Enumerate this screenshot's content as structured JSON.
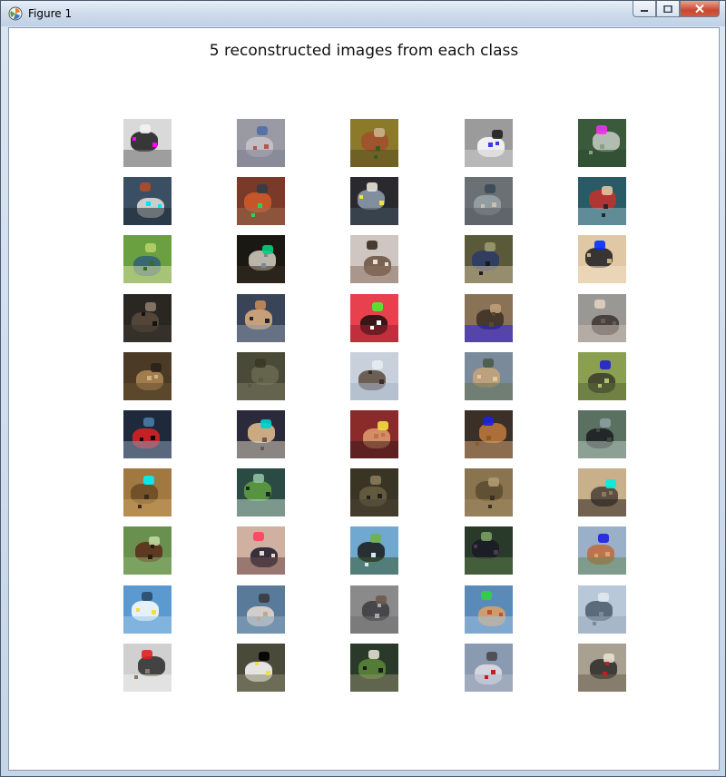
{
  "window": {
    "title": "Figure 1",
    "app_icon": "matplotlib-icon",
    "controls": [
      "minimize-icon",
      "maximize-icon",
      "close-icon"
    ]
  },
  "figure": {
    "title": "5 reconstructed images from each class",
    "rows": 10,
    "cols": 5
  },
  "images": [
    [
      {
        "bg": "#d9d9d9",
        "c1": "#1a1a1a",
        "c2": "#f2f2f2",
        "c3": "#ff00ff",
        "c4": "#6d6d6d"
      },
      {
        "bg": "#9a9aa4",
        "c1": "#c9c4cc",
        "c2": "#4f6fa8",
        "c3": "#b0574e",
        "c4": "#7b7f8f"
      },
      {
        "bg": "#8a7a2a",
        "c1": "#a14f2c",
        "c2": "#c9b08a",
        "c3": "#3a5a24",
        "c4": "#5a4a20"
      },
      {
        "bg": "#9b9b9b",
        "c1": "#ffffff",
        "c2": "#202020",
        "c3": "#3a3af0",
        "c4": "#d0d0d0"
      },
      {
        "bg": "#3b5a3c",
        "c1": "#c8cfc6",
        "c2": "#ee33ee",
        "c3": "#8aa37e",
        "c4": "#2d4a30"
      }
    ],
    [
      {
        "bg": "#3a4f63",
        "c1": "#e8e2dc",
        "c2": "#b04a2a",
        "c3": "#00e5ff",
        "c4": "#1d2a35"
      },
      {
        "bg": "#7a3a2a",
        "c1": "#d45a2a",
        "c2": "#333c46",
        "c3": "#2ed05c",
        "c4": "#9c6a4a"
      },
      {
        "bg": "#2a2a2e",
        "c1": "#8fa0b0",
        "c2": "#e7e2d8",
        "c3": "#f5e04a",
        "c4": "#445566"
      },
      {
        "bg": "#6a7074",
        "c1": "#9aa3a8",
        "c2": "#3a4a56",
        "c3": "#c8c0b0",
        "c4": "#555d62"
      },
      {
        "bg": "#2a5a66",
        "c1": "#c8302a",
        "c2": "#e2c4a0",
        "c3": "#1f2a30",
        "c4": "#8ab6c0"
      }
    ],
    [
      {
        "bg": "#6aa040",
        "c1": "#2f5f7a",
        "c2": "#b6d06a",
        "c3": "#3c6a28",
        "c4": "#d9e0a0"
      },
      {
        "bg": "#1a1812",
        "c1": "#d8d0c4",
        "c2": "#00d080",
        "c3": "#7a8898",
        "c4": "#3a3024"
      },
      {
        "bg": "#cfc6c2",
        "c1": "#6a5040",
        "c2": "#3a2c22",
        "c3": "#e6e0dc",
        "c4": "#8a7060"
      },
      {
        "bg": "#5a5a3a",
        "c1": "#2a3a6a",
        "c2": "#9a9a70",
        "c3": "#1a1a16",
        "c4": "#c8b898"
      },
      {
        "bg": "#e0c8a4",
        "c1": "#1a1a20",
        "c2": "#0030ff",
        "c3": "#c8ac84",
        "c4": "#f2e0c4"
      }
    ],
    [
      {
        "bg": "#2a2622",
        "c1": "#5a4c3c",
        "c2": "#8a7a6a",
        "c3": "#141210",
        "c4": "#3e3830"
      },
      {
        "bg": "#3a4458",
        "c1": "#e0b080",
        "c2": "#c48a5a",
        "c3": "#1e2430",
        "c4": "#8a98a8"
      },
      {
        "bg": "#e8404c",
        "c1": "#1a1010",
        "c2": "#50f030",
        "c3": "#ffffff",
        "c4": "#a02030"
      },
      {
        "bg": "#8a7256",
        "c1": "#3a2e22",
        "c2": "#c0a07a",
        "c3": "#5a4632",
        "c4": "#2a20ee"
      },
      {
        "bg": "#9a9894",
        "c1": "#3a3230",
        "c2": "#e0d0c0",
        "c3": "#6a5a50",
        "c4": "#c8bcb0"
      }
    ],
    [
      {
        "bg": "#4a3a26",
        "c1": "#b08a56",
        "c2": "#2a2218",
        "c3": "#d0b080",
        "c4": "#6a5230"
      },
      {
        "bg": "#4a4a38",
        "c1": "#6a6850",
        "c2": "#383828",
        "c3": "#5a5844",
        "c4": "#7a7a60"
      },
      {
        "bg": "#c8d0dc",
        "c1": "#5a4a3c",
        "c2": "#e8ecf2",
        "c3": "#3a2e26",
        "c4": "#a8b4c4"
      },
      {
        "bg": "#7a8a9a",
        "c1": "#c8a47a",
        "c2": "#4a5a4a",
        "c3": "#e0c8a0",
        "c4": "#6a7456"
      },
      {
        "bg": "#8aa050",
        "c1": "#3a3a2a",
        "c2": "#2020d0",
        "c3": "#b0c070",
        "c4": "#5a6a3a"
      }
    ],
    [
      {
        "bg": "#1e2a3c",
        "c1": "#e02020",
        "c2": "#4a7aa8",
        "c3": "#0a0a0e",
        "c4": "#8a9ab0"
      },
      {
        "bg": "#2a2a3a",
        "c1": "#e8c090",
        "c2": "#00d0d0",
        "c3": "#6a5a4a",
        "c4": "#d8d0c0"
      },
      {
        "bg": "#8a2a2a",
        "c1": "#e0a070",
        "c2": "#f0e040",
        "c3": "#c07050",
        "c4": "#3a1a1a"
      },
      {
        "bg": "#3a3028",
        "c1": "#c07a3a",
        "c2": "#2020e0",
        "c3": "#8a5a30",
        "c4": "#d0a070"
      },
      {
        "bg": "#5a7060",
        "c1": "#1a1a20",
        "c2": "#8aa0a0",
        "c3": "#3a4a40",
        "c4": "#b8c8c0"
      }
    ],
    [
      {
        "bg": "#a07840",
        "c1": "#6a4a26",
        "c2": "#00f0ff",
        "c3": "#3a2a1a",
        "c4": "#c8a060"
      },
      {
        "bg": "#2a4a44",
        "c1": "#60a040",
        "c2": "#90c0a0",
        "c3": "#1a2a2a",
        "c4": "#c0d8c8"
      },
      {
        "bg": "#3a3424",
        "c1": "#6a6044",
        "c2": "#8a7a5a",
        "c3": "#24201a",
        "c4": "#4a4434"
      },
      {
        "bg": "#8a7450",
        "c1": "#5a4a30",
        "c2": "#b09a70",
        "c3": "#3a3020",
        "c4": "#a08a60"
      },
      {
        "bg": "#c8b08a",
        "c1": "#4a4036",
        "c2": "#00f0e0",
        "c3": "#8a7a60",
        "c4": "#2a2420"
      }
    ],
    [
      {
        "bg": "#6a9050",
        "c1": "#5a2a1a",
        "c2": "#c0d8a0",
        "c3": "#2a1a10",
        "c4": "#8ab070"
      },
      {
        "bg": "#d0b0a0",
        "c1": "#1a1a2a",
        "c2": "#ff4060",
        "c3": "#e8d8d0",
        "c4": "#6a4a4a"
      },
      {
        "bg": "#70a8d0",
        "c1": "#1a1a1a",
        "c2": "#70b050",
        "c3": "#d8e8f0",
        "c4": "#3a5a30"
      },
      {
        "bg": "#2a3a2a",
        "c1": "#1a1a24",
        "c2": "#7aa060",
        "c3": "#4a3a50",
        "c4": "#5a7a48"
      },
      {
        "bg": "#9ab0c8",
        "c1": "#c06a3a",
        "c2": "#2020e0",
        "c3": "#e0a070",
        "c4": "#6a8a5a"
      }
    ],
    [
      {
        "bg": "#5a9ad0",
        "c1": "#ffffff",
        "c2": "#2a4a6a",
        "c3": "#f0e040",
        "c4": "#a0c8e8"
      },
      {
        "bg": "#5a7a9a",
        "c1": "#e8dcd0",
        "c2": "#3a3a40",
        "c3": "#c0a890",
        "c4": "#8aa8c0"
      },
      {
        "bg": "#8a8a8a",
        "c1": "#3a3a40",
        "c2": "#6a5a4a",
        "c3": "#a8a8a8",
        "c4": "#707070"
      },
      {
        "bg": "#5a8ab8",
        "c1": "#e0a060",
        "c2": "#30d040",
        "c3": "#c05030",
        "c4": "#a0c0e0"
      },
      {
        "bg": "#b8c8d8",
        "c1": "#4a5a6a",
        "c2": "#e0e8f0",
        "c3": "#7a8a9a",
        "c4": "#9aaabb"
      }
    ],
    [
      {
        "bg": "#d0d0d0",
        "c1": "#2a2a2a",
        "c2": "#e02020",
        "c3": "#8a7a6a",
        "c4": "#f0f0f0"
      },
      {
        "bg": "#4a4a3a",
        "c1": "#ffffff",
        "c2": "#000000",
        "c3": "#f0e040",
        "c4": "#8a8a70"
      },
      {
        "bg": "#2a3a2a",
        "c1": "#5a8a3a",
        "c2": "#e0e0d0",
        "c3": "#1a1a1a",
        "c4": "#8a8a6a"
      },
      {
        "bg": "#8a9ab0",
        "c1": "#e0e0e8",
        "c2": "#4a4a50",
        "c3": "#c02020",
        "c4": "#b0b8c8"
      },
      {
        "bg": "#a8a090",
        "c1": "#2a2a2a",
        "c2": "#e8e0d0",
        "c3": "#c02020",
        "c4": "#6a6050"
      }
    ]
  ]
}
